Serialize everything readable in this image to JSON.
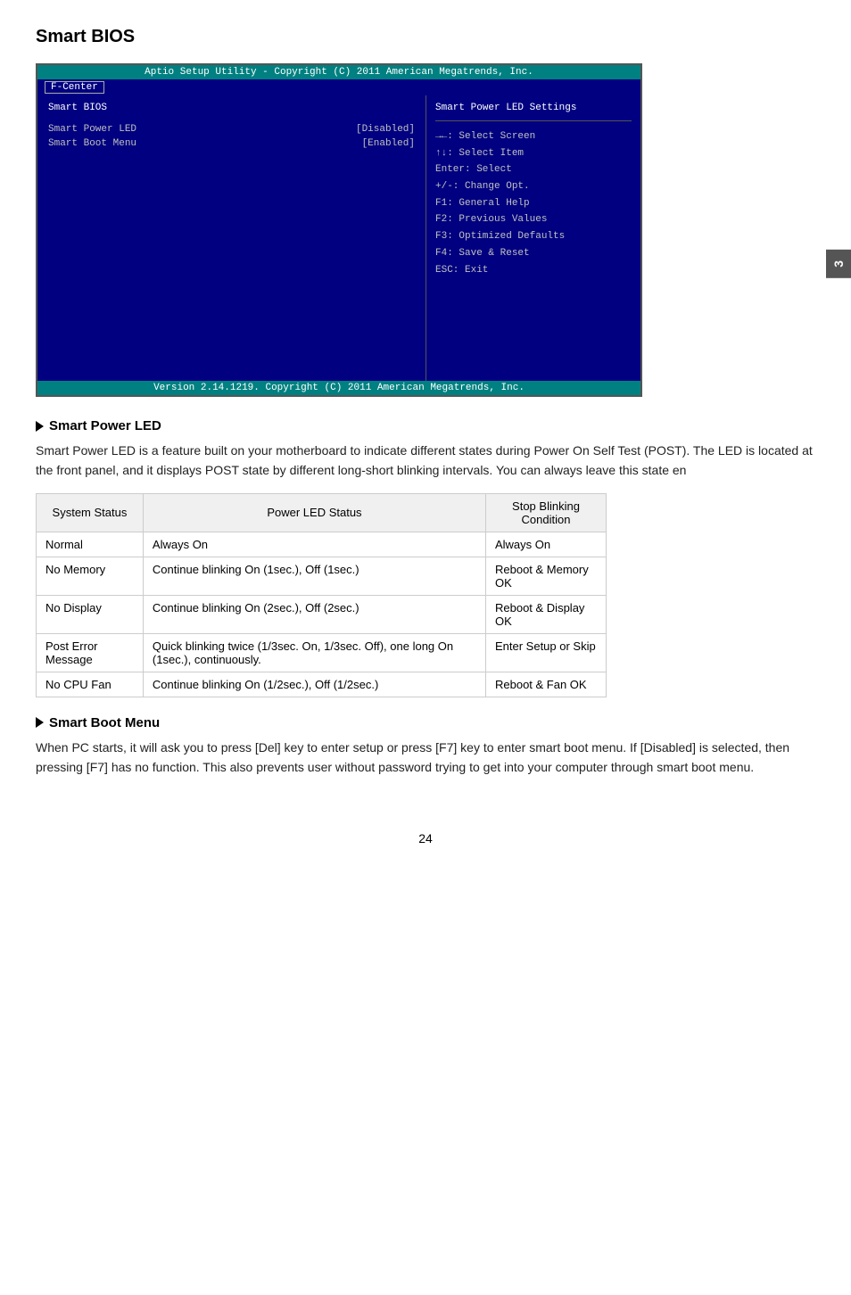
{
  "page": {
    "title": "Smart BIOS",
    "number": "24"
  },
  "side_tab": {
    "label": "3"
  },
  "bios": {
    "header": "Aptio Setup Utility - Copyright (C) 2011 American Megatrends, Inc.",
    "tab": "F-Center",
    "section_title": "Smart BIOS",
    "right_panel_title": "Smart Power LED Settings",
    "options": [
      {
        "label": "Smart Power LED",
        "value": "[Disabled]"
      },
      {
        "label": "Smart Boot Menu",
        "value": "[Enabled]"
      }
    ],
    "keys": [
      "→←: Select Screen",
      "↑↓: Select Item",
      "Enter: Select",
      "+/-: Change Opt.",
      "F1: General Help",
      "F2: Previous Values",
      "F3: Optimized Defaults",
      "F4: Save & Reset",
      "ESC: Exit"
    ],
    "footer": "Version 2.14.1219. Copyright (C) 2011 American Megatrends, Inc."
  },
  "smart_power_led": {
    "heading": "Smart Power LED",
    "description": "Smart Power LED is a feature built on your motherboard to indicate different states during Power On Self Test (POST). The LED is located at the front panel, and it displays POST state by different long-short blinking intervals. You can always leave this state en",
    "table": {
      "headers": [
        "System Status",
        "Power LED Status",
        "Stop Blinking Condition"
      ],
      "rows": [
        [
          "Normal",
          "Always On",
          "Always On"
        ],
        [
          "No Memory",
          "Continue blinking On (1sec.), Off (1sec.)",
          "Reboot & Memory OK"
        ],
        [
          "No Display",
          "Continue blinking On (2sec.), Off (2sec.)",
          "Reboot & Display OK"
        ],
        [
          "Post Error Message",
          "Quick blinking twice (1/3sec. On, 1/3sec. Off), one long On (1sec.), continuously.",
          "Enter Setup or Skip"
        ],
        [
          "No CPU Fan",
          "Continue blinking On (1/2sec.), Off (1/2sec.)",
          "Reboot & Fan OK"
        ]
      ]
    }
  },
  "smart_boot_menu": {
    "heading": "Smart Boot Menu",
    "description": "When PC starts, it will ask you to press [Del] key to enter setup or press [F7] key to enter smart boot menu. If [Disabled] is selected, then pressing [F7] has no function. This also prevents user without password trying to get into your computer through smart boot menu."
  }
}
